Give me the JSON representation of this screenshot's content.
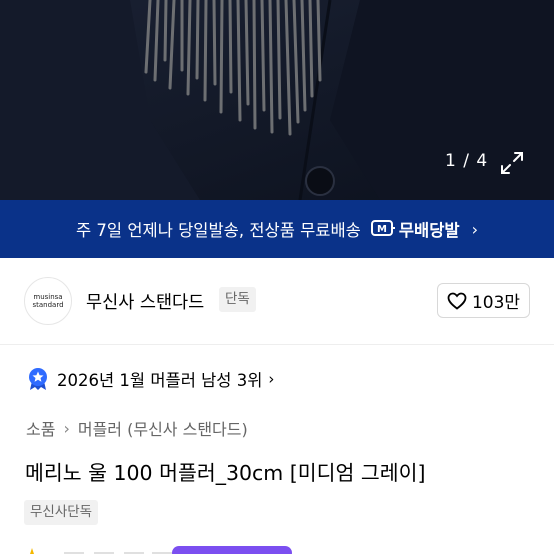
{
  "gallery": {
    "counter": "1 / 4",
    "expand_icon": "expand-icon"
  },
  "banner": {
    "text": "주 7일 언제나 당일발송, 전상품 무료배송",
    "badge_label": "무배당발",
    "badge_icon": "m-delivery-icon",
    "chevron": "›",
    "bg_color": "#0a3289"
  },
  "brand": {
    "logo_line1": "musinsa",
    "logo_line2": "standard",
    "name": "무신사 스탠다드",
    "tag": "단독",
    "like_count": "103만",
    "like_icon": "heart-icon"
  },
  "ranking": {
    "text": "2026년 1월 머플러 남성 3위",
    "icon": "rank-badge-icon",
    "chevron": "›"
  },
  "breadcrumb": {
    "items": [
      "소품",
      "머플러 (무신사 스탠다드)"
    ],
    "separator": "›"
  },
  "product": {
    "title": "메리노 울 100 머플러_30cm [미디엄 그레이]",
    "tag": "무신사단독"
  }
}
